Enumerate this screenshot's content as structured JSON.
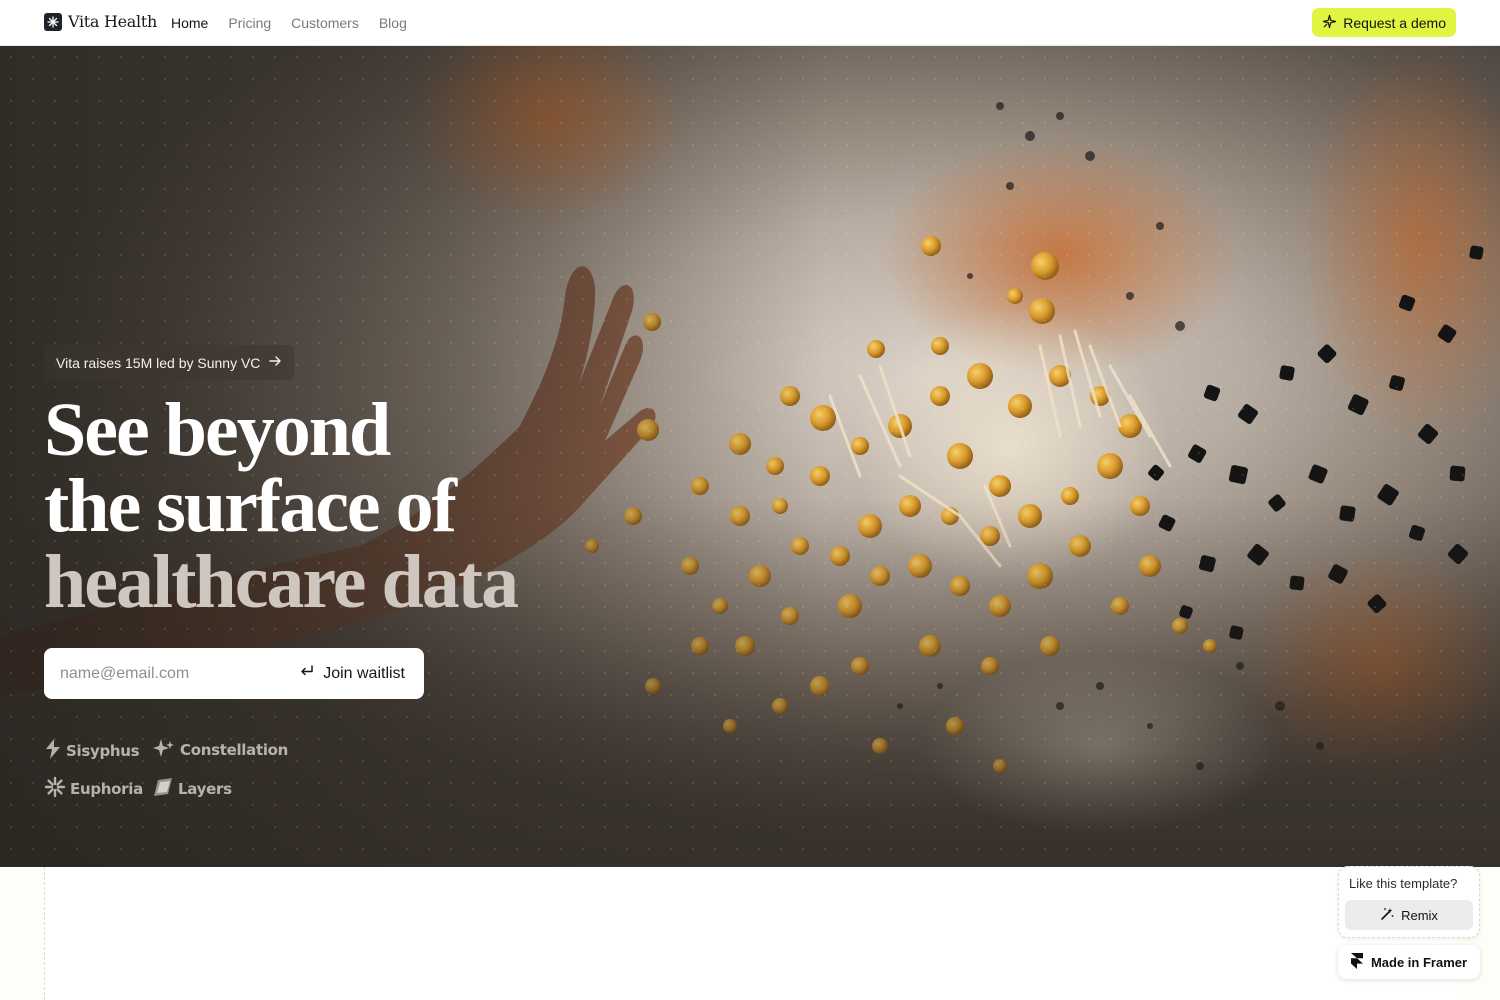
{
  "brand": {
    "name": "Vita Health"
  },
  "nav": {
    "links": [
      {
        "label": "Home",
        "active": true
      },
      {
        "label": "Pricing",
        "active": false
      },
      {
        "label": "Customers",
        "active": false
      },
      {
        "label": "Blog",
        "active": false
      }
    ],
    "cta_label": "Request a demo",
    "cta_color": "#dff541"
  },
  "hero": {
    "announcement": "Vita raises 15M led by Sunny VC",
    "headline_lines": [
      "See beyond",
      "the surface of",
      "healthcare data"
    ],
    "email_placeholder": "name@email.com",
    "join_label": "Join waitlist",
    "partner_logos": [
      {
        "name": "Sisyphus",
        "icon": "bolt-icon"
      },
      {
        "name": "Constellation",
        "icon": "sparkle-icon"
      },
      {
        "name": "Euphoria",
        "icon": "burst-icon"
      },
      {
        "name": "Layers",
        "icon": "layers-icon"
      }
    ]
  },
  "framer": {
    "prompt": "Like this template?",
    "remix_label": "Remix",
    "badge_label": "Made in Framer"
  }
}
